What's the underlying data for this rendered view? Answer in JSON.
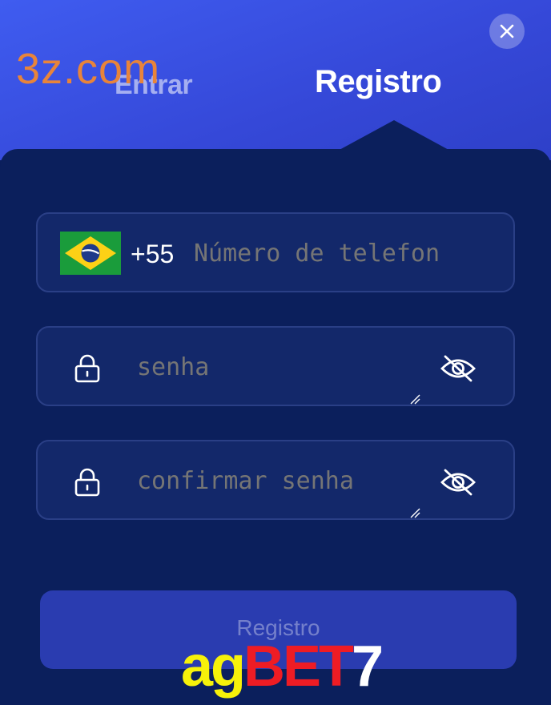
{
  "header": {
    "tabs": [
      {
        "label": "Entrar",
        "active": false
      },
      {
        "label": "Registro",
        "active": true
      }
    ],
    "close_icon": "close-icon"
  },
  "watermarks": {
    "top_left": "3z.com",
    "brand_part1": "ag",
    "brand_part2": "BET",
    "brand_part3": "7"
  },
  "form": {
    "phone": {
      "country_flag": "brazil-flag-icon",
      "country_code": "+55",
      "placeholder": "Número de telefon",
      "value": ""
    },
    "password": {
      "placeholder": "senha",
      "value": "",
      "lock_icon": "lock-icon",
      "visibility_icon": "eye-off-icon"
    },
    "confirm_password": {
      "placeholder": "confirmar senha",
      "value": "",
      "lock_icon": "lock-icon",
      "visibility_icon": "eye-off-icon"
    },
    "submit_label": "Registro"
  },
  "colors": {
    "header_gradient_start": "#3f5cf0",
    "panel_bg": "#0b1f5c",
    "field_bg": "#13286a",
    "field_border": "#2a3f86",
    "button_bg": "#2a3cb0",
    "watermark_orange": "#e8843a",
    "brand_yellow": "#f7f20a",
    "brand_red": "#ee1c24"
  }
}
